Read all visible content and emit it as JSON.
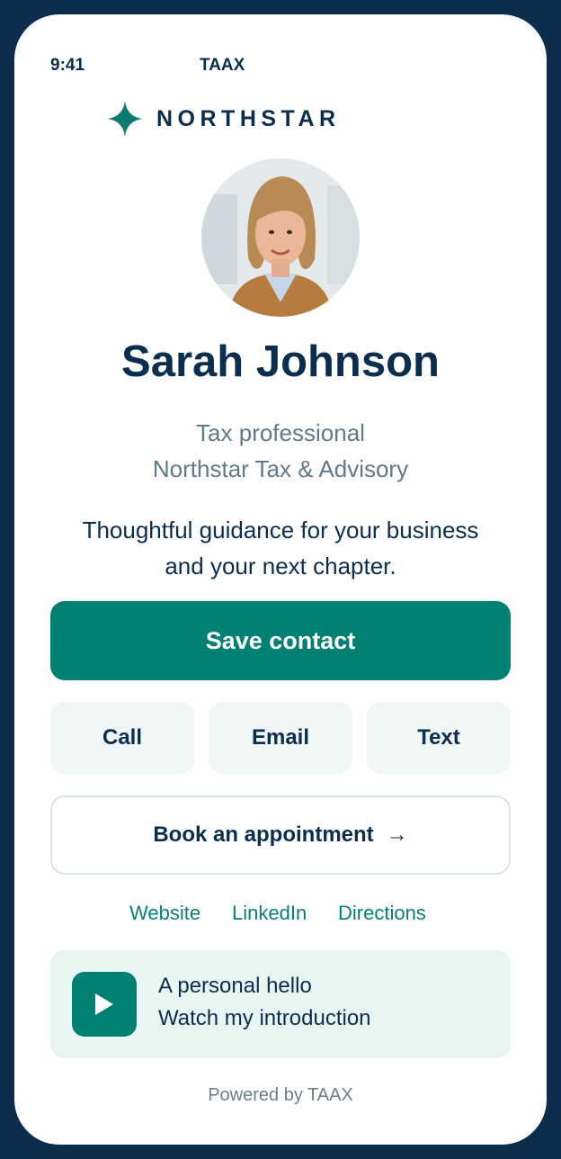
{
  "status_bar": {
    "time": "9:41",
    "carrier": "TAAX"
  },
  "brand": {
    "name": "NORTHSTAR",
    "icon": "four-point-star-icon",
    "color": "#0f7b70"
  },
  "profile": {
    "name": "Sarah Johnson",
    "role": "Tax professional",
    "company": "Northstar Tax & Advisory",
    "bio": "Thoughtful guidance for your business and your next chapter."
  },
  "actions": {
    "save_label": "Save contact",
    "quick": [
      {
        "label": "Call"
      },
      {
        "label": "Email"
      },
      {
        "label": "Text"
      }
    ],
    "book_label": "Book an appointment",
    "book_icon": "arrow-right-icon"
  },
  "links": [
    {
      "label": "Website"
    },
    {
      "label": "LinkedIn"
    },
    {
      "label": "Directions"
    }
  ],
  "video": {
    "title": "A personal hello",
    "subtitle": "Watch my introduction",
    "icon": "play-icon"
  },
  "footer": {
    "powered": "Powered by TAAX"
  },
  "colors": {
    "primary": "#007f73",
    "text_dark": "#0b2e4e",
    "text_muted": "#5f7a88",
    "frame": "#0b2e4e",
    "quick_bg": "#f1f6f7",
    "video_bg": "#e8f6f3"
  }
}
